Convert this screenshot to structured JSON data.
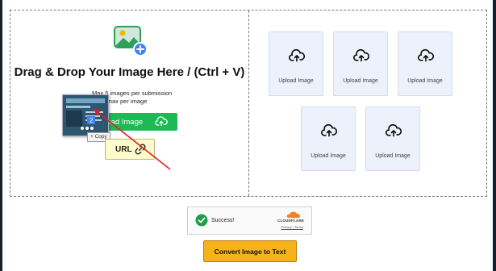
{
  "dropzone": {
    "heading": "Drag & Drop Your Image Here / (Ctrl + V)",
    "limit_count": "Max 5 images per submission",
    "limit_size": "1 mb max per image",
    "upload_button_label": "Upload Image",
    "copy_badge": "+ Copy",
    "url_button_label": "URL",
    "thumbnail_badge": "2"
  },
  "slots": [
    {
      "label": "Upload Image"
    },
    {
      "label": "Upload Image"
    },
    {
      "label": "Upload Image"
    },
    {
      "label": "Upload Image"
    },
    {
      "label": "Upload Image"
    }
  ],
  "captcha": {
    "status": "Success!",
    "brand": "CLOUDFLARE",
    "links": "Privacy • Terms"
  },
  "convert_button_label": "Convert Image to Text",
  "colors": {
    "upload_green": "#1db954",
    "url_yellow": "#fdfbcc",
    "convert_orange": "#f5b21b",
    "slot_bg": "#edf1fb",
    "annotation_red": "#e02020"
  }
}
